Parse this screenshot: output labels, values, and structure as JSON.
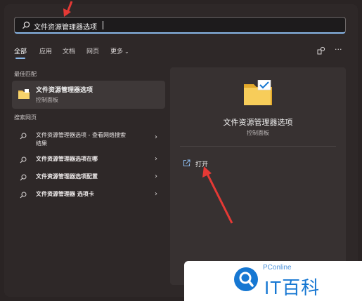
{
  "search": {
    "value": "文件资源管理器选项",
    "icon": "search-icon"
  },
  "tabs": [
    {
      "label": "全部"
    },
    {
      "label": "应用"
    },
    {
      "label": "文档"
    },
    {
      "label": "网页"
    },
    {
      "label": "更多"
    }
  ],
  "toolbar": {
    "share_icon": "share-icon",
    "more_icon": "more-icon",
    "more_glyph": "···"
  },
  "best_match": {
    "section": "最佳匹配",
    "title": "文件资源管理器选项",
    "subtitle": "控制面板"
  },
  "web": {
    "section": "搜索网页",
    "rows": [
      {
        "bold": "文件资源管理器选项",
        "rest": " - 查看网络搜索",
        "line2": "结果"
      },
      {
        "bold": "文件资源管理器选项在哪",
        "rest": "",
        "line2": ""
      },
      {
        "bold": "文件资源管理器选项配置",
        "rest": "",
        "line2": ""
      },
      {
        "bold": "文件资源管理器 选项卡",
        "rest": "",
        "line2": ""
      }
    ]
  },
  "detail": {
    "title": "文件资源管理器选项",
    "subtitle": "控制面板",
    "action": "打开"
  },
  "logo": {
    "brand": "PConline",
    "name": "IT百科"
  },
  "colors": {
    "accent": "#8ab7e8",
    "annotation": "#e53935",
    "brand": "#1677d2"
  }
}
